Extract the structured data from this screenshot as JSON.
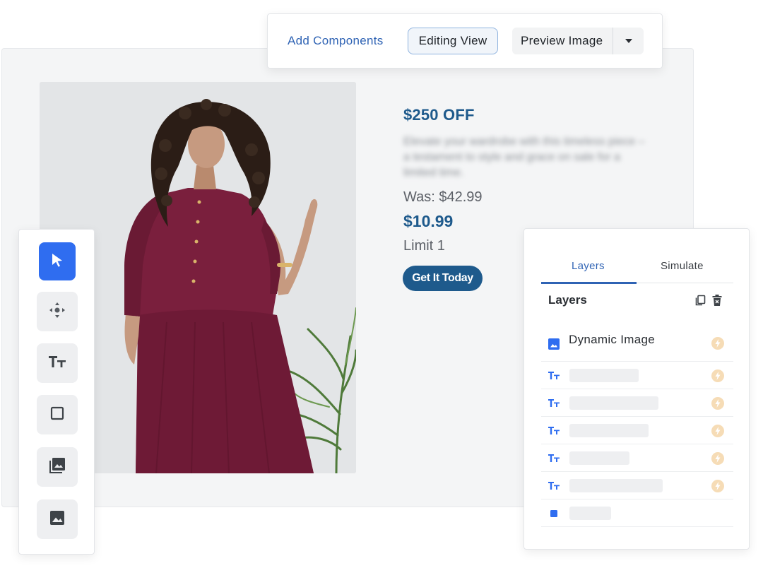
{
  "toolbar": {
    "add_components": "Add Components",
    "editing_view": "Editing View",
    "preview_image": "Preview Image"
  },
  "ad": {
    "headline": "$250 OFF",
    "description": "Elevate your wardrobe with this timeless piece – a testament to style and grace on sale for a limited time.",
    "was_price": "Was: $42.99",
    "price": "$10.99",
    "limit": "Limit 1",
    "cta": "Get It Today"
  },
  "tools": [
    {
      "icon": "cursor-icon",
      "active": true
    },
    {
      "icon": "move-icon",
      "active": false
    },
    {
      "icon": "text-icon",
      "active": false
    },
    {
      "icon": "square-icon",
      "active": false
    },
    {
      "icon": "image-gallery-icon",
      "active": false
    },
    {
      "icon": "image-icon",
      "active": false
    }
  ],
  "layers_panel": {
    "tabs": [
      "Layers",
      "Simulate"
    ],
    "active_tab": "Layers",
    "title": "Layers",
    "items": [
      {
        "type": "image",
        "icon": "image-icon",
        "name": "Dynamic Image"
      },
      {
        "type": "text",
        "icon": "text-icon"
      },
      {
        "type": "text",
        "icon": "text-icon"
      },
      {
        "type": "text",
        "icon": "text-icon"
      },
      {
        "type": "text",
        "icon": "text-icon"
      },
      {
        "type": "text",
        "icon": "text-icon"
      },
      {
        "type": "shape",
        "icon": "square-icon"
      }
    ]
  },
  "colors": {
    "brand_blue": "#1e5a8c",
    "accent_blue": "#2f6df0",
    "link_blue": "#2f63b4",
    "dress": "#7a1f3d",
    "bolt": "#f2c98f"
  }
}
